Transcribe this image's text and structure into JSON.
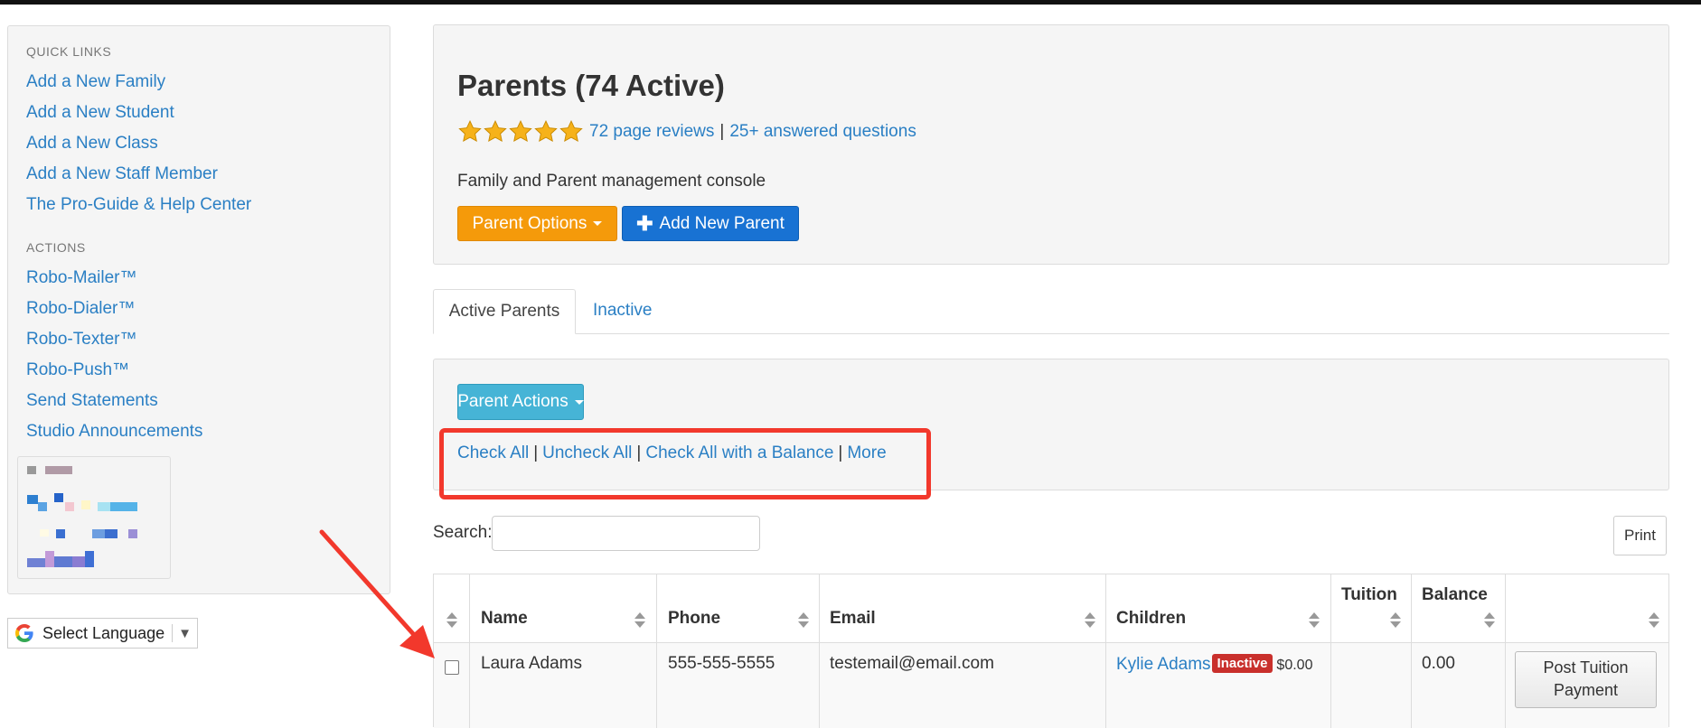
{
  "sidebar": {
    "quick_links_heading": "QUICK LINKS",
    "quick_links": [
      "Add a New Family",
      "Add a New Student",
      "Add a New Class",
      "Add a New Staff Member",
      "The Pro-Guide & Help Center"
    ],
    "actions_heading": "ACTIONS",
    "actions": [
      "Robo-Mailer™",
      "Robo-Dialer™",
      "Robo-Texter™",
      "Robo-Push™",
      "Send Statements",
      "Studio Announcements"
    ]
  },
  "language": {
    "label": "Select Language",
    "arrow": "▼",
    "icon": "google-g-icon"
  },
  "header": {
    "title": "Parents (74 Active)",
    "stars": 5,
    "reviews_link": "72 page reviews",
    "separator": "|",
    "questions_link": "25+ answered questions",
    "description": "Family and Parent management console",
    "parent_options_label": "Parent Options",
    "add_parent_label": "Add New Parent"
  },
  "tabs": {
    "active": "Active Parents",
    "inactive": "Inactive"
  },
  "actions_panel": {
    "parent_actions_label": "Parent Actions",
    "links": [
      "Check All",
      "Uncheck All",
      "Check All with a Balance",
      "More"
    ],
    "separator": "|"
  },
  "search": {
    "label": "Search:",
    "value": "",
    "placeholder": ""
  },
  "print_label": "Print",
  "table": {
    "columns": [
      "Name",
      "Phone",
      "Email",
      "Children",
      "Tuition",
      "Balance"
    ],
    "rows": [
      {
        "name": "Laura Adams",
        "phone": "555-555-5555",
        "email": "testemail@email.com",
        "child": "Kylie Adams",
        "child_status": "Inactive",
        "child_amount": "$0.00",
        "tuition": "",
        "balance": "0.00",
        "action_line1": "Post Tuition",
        "action_line2": "Payment"
      }
    ]
  },
  "colors": {
    "link": "#2a7fc4",
    "orange_button": "#f59a0a",
    "blue_button": "#1872d3",
    "teal_button": "#46b4d6",
    "inactive_badge": "#c9302c",
    "annotation_red": "#f2382c",
    "star": "#f6b21a"
  }
}
